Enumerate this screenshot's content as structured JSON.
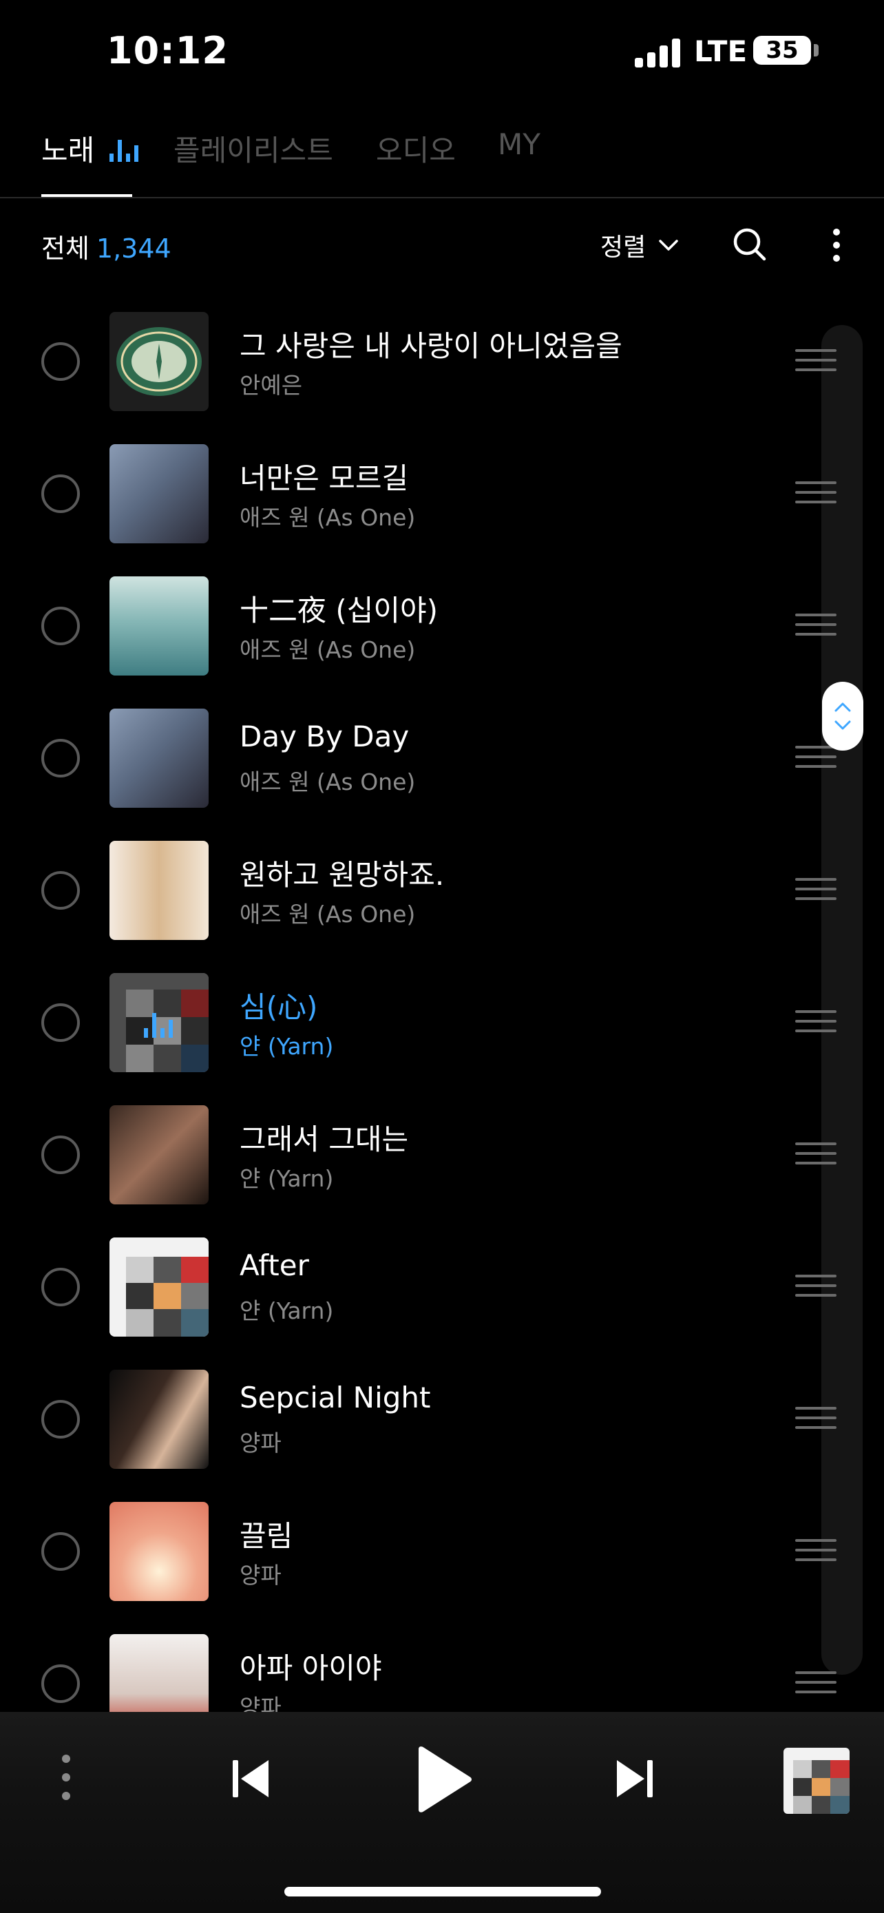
{
  "status_bar": {
    "time": "10:12",
    "network": "LTE",
    "battery": "35"
  },
  "tabs": [
    {
      "label": "노래",
      "active": true
    },
    {
      "label": "플레이리스트",
      "active": false
    },
    {
      "label": "오디오",
      "active": false
    },
    {
      "label": "MY",
      "active": false
    }
  ],
  "toolbar": {
    "count_label": "전체",
    "count_value": "1,344",
    "sort_label": "정렬"
  },
  "songs": [
    {
      "title": "그 사랑은 내 사랑이 아니었음을",
      "artist": "안예은"
    },
    {
      "title": "너만은 모르길",
      "artist": "애즈 원 (As One)"
    },
    {
      "title": "十二夜 (십이야)",
      "artist": "애즈 원 (As One)"
    },
    {
      "title": "Day By Day",
      "artist": "애즈 원 (As One)"
    },
    {
      "title": "원하고 원망하죠.",
      "artist": "애즈 원 (As One)"
    },
    {
      "title": "심(心)",
      "artist": "얀 (Yarn)",
      "playing": true
    },
    {
      "title": "그래서 그대는",
      "artist": "얀 (Yarn)"
    },
    {
      "title": "After",
      "artist": "얀 (Yarn)"
    },
    {
      "title": "Sepcial Night",
      "artist": "양파"
    },
    {
      "title": "끌림",
      "artist": "양파"
    },
    {
      "title": "아파 아이야",
      "artist": "양파"
    }
  ],
  "colors": {
    "accent": "#3fa7ff",
    "background": "#000000",
    "muted": "#8c8c8c"
  }
}
